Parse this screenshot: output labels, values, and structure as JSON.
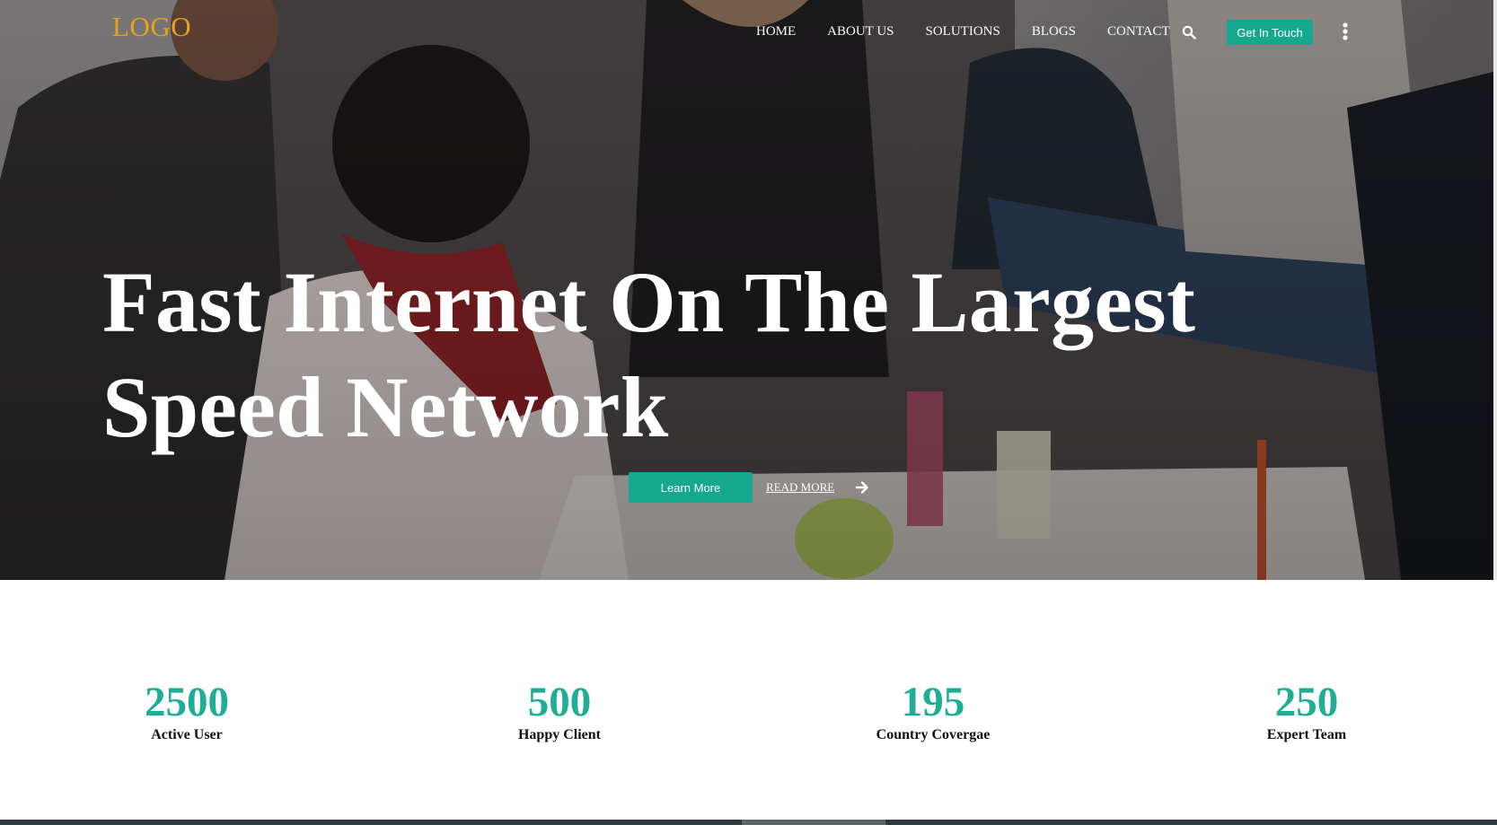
{
  "brand": {
    "logo_text": "LOGO",
    "logo_color": "#e8a21f"
  },
  "nav": {
    "items": [
      {
        "label": "HOME"
      },
      {
        "label": "ABOUT US"
      },
      {
        "label": "SOLUTIONS"
      },
      {
        "label": "BLOGS"
      },
      {
        "label": "CONTACT"
      }
    ],
    "search_icon": "search-icon",
    "cta_label": "Get In Touch",
    "more_icon": "vertical-dots-icon"
  },
  "hero": {
    "headline_line1": "Fast Internet On The Largest",
    "headline_line2": "Speed Network",
    "primary_button": "Learn More",
    "secondary_link": "READ MORE",
    "secondary_icon": "arrow-right-icon"
  },
  "stats": [
    {
      "value": "2500",
      "label": "Active User"
    },
    {
      "value": "500",
      "label": "Happy Client"
    },
    {
      "value": "195",
      "label": "Country Covergae"
    },
    {
      "value": "250",
      "label": "Expert Team"
    }
  ],
  "colors": {
    "accent": "#16a88f",
    "stat_number": "#1fae95",
    "nav_text": "#ffffff"
  }
}
